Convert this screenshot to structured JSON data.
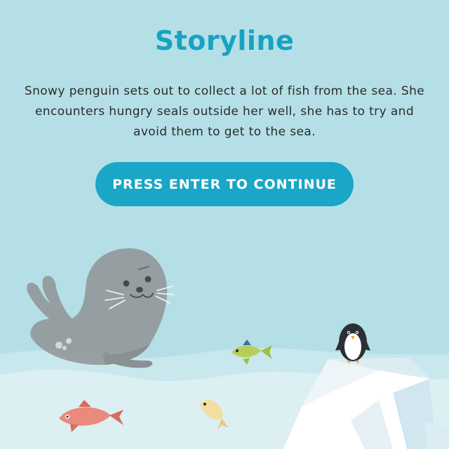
{
  "screen": {
    "title": "Storyline",
    "story_text": "Snowy penguin sets out to collect a lot of fish from the sea. She encounters hungry seals outside her well, she has to try and avoid them to get to the sea.",
    "continue_label": "PRESS ENTER TO CONTINUE"
  },
  "colors": {
    "background": "#b5dfe6",
    "accent": "#1aa6c6",
    "title": "#16a3c3",
    "text": "#2b2b2b",
    "water_light": "#d8eef1"
  },
  "scene": {
    "characters": [
      "seal",
      "penguin",
      "fish-green",
      "fish-red",
      "fish-yellow"
    ],
    "terrain": [
      "ice-floe",
      "water-waves"
    ]
  }
}
